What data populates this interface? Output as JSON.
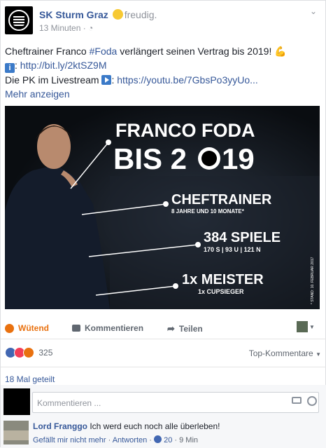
{
  "header": {
    "page_name": "SK Sturm Graz",
    "feeling": "freudig.",
    "time": "13 Minuten",
    "privacy_icon": "globe-icon"
  },
  "post": {
    "text_pre": "Cheftrainer Franco ",
    "hashtag": "#Foda",
    "text_post": " verlängert seinen Vertrag bis 2019! ",
    "link1": "http://bit.ly/2ktSZ9M",
    "pk_label": "Die PK im Livestream ",
    "link2": "https://youtu.be/7GbsPo3yyUo...",
    "more": "Mehr anzeigen"
  },
  "graphic": {
    "line1": "FRANCO FODA",
    "line2a": "BIS 2",
    "line2b": "19",
    "chef": "CHEFTRAINER",
    "chef_sub": "8 JAHRE UND 10 MONATE*",
    "spiele": "384 SPIELE",
    "spiele_sub": "170 S | 93 U | 121 N",
    "meister": "1x MEISTER",
    "meister_sub": "1x CUPSIEGER",
    "footnote": "* STAND: 10. FEBRUAR 2017"
  },
  "actions": {
    "react": "Wütend",
    "comment": "Kommentieren",
    "share": "Teilen"
  },
  "reactions": {
    "count": "325",
    "sort": "Top-Kommentare"
  },
  "shares": "18 Mal geteilt",
  "composer": {
    "placeholder": "Kommentieren ..."
  },
  "comment": {
    "author": "Lord Franggo",
    "text": "Ich werd euch noch alle überleben!",
    "like": "Gefällt mir nicht mehr",
    "reply": "Antworten",
    "likes": "20",
    "age": "9 Min"
  },
  "colors": {
    "link": "#365899",
    "angry": "#e9710f",
    "bg": "#0d1014"
  }
}
